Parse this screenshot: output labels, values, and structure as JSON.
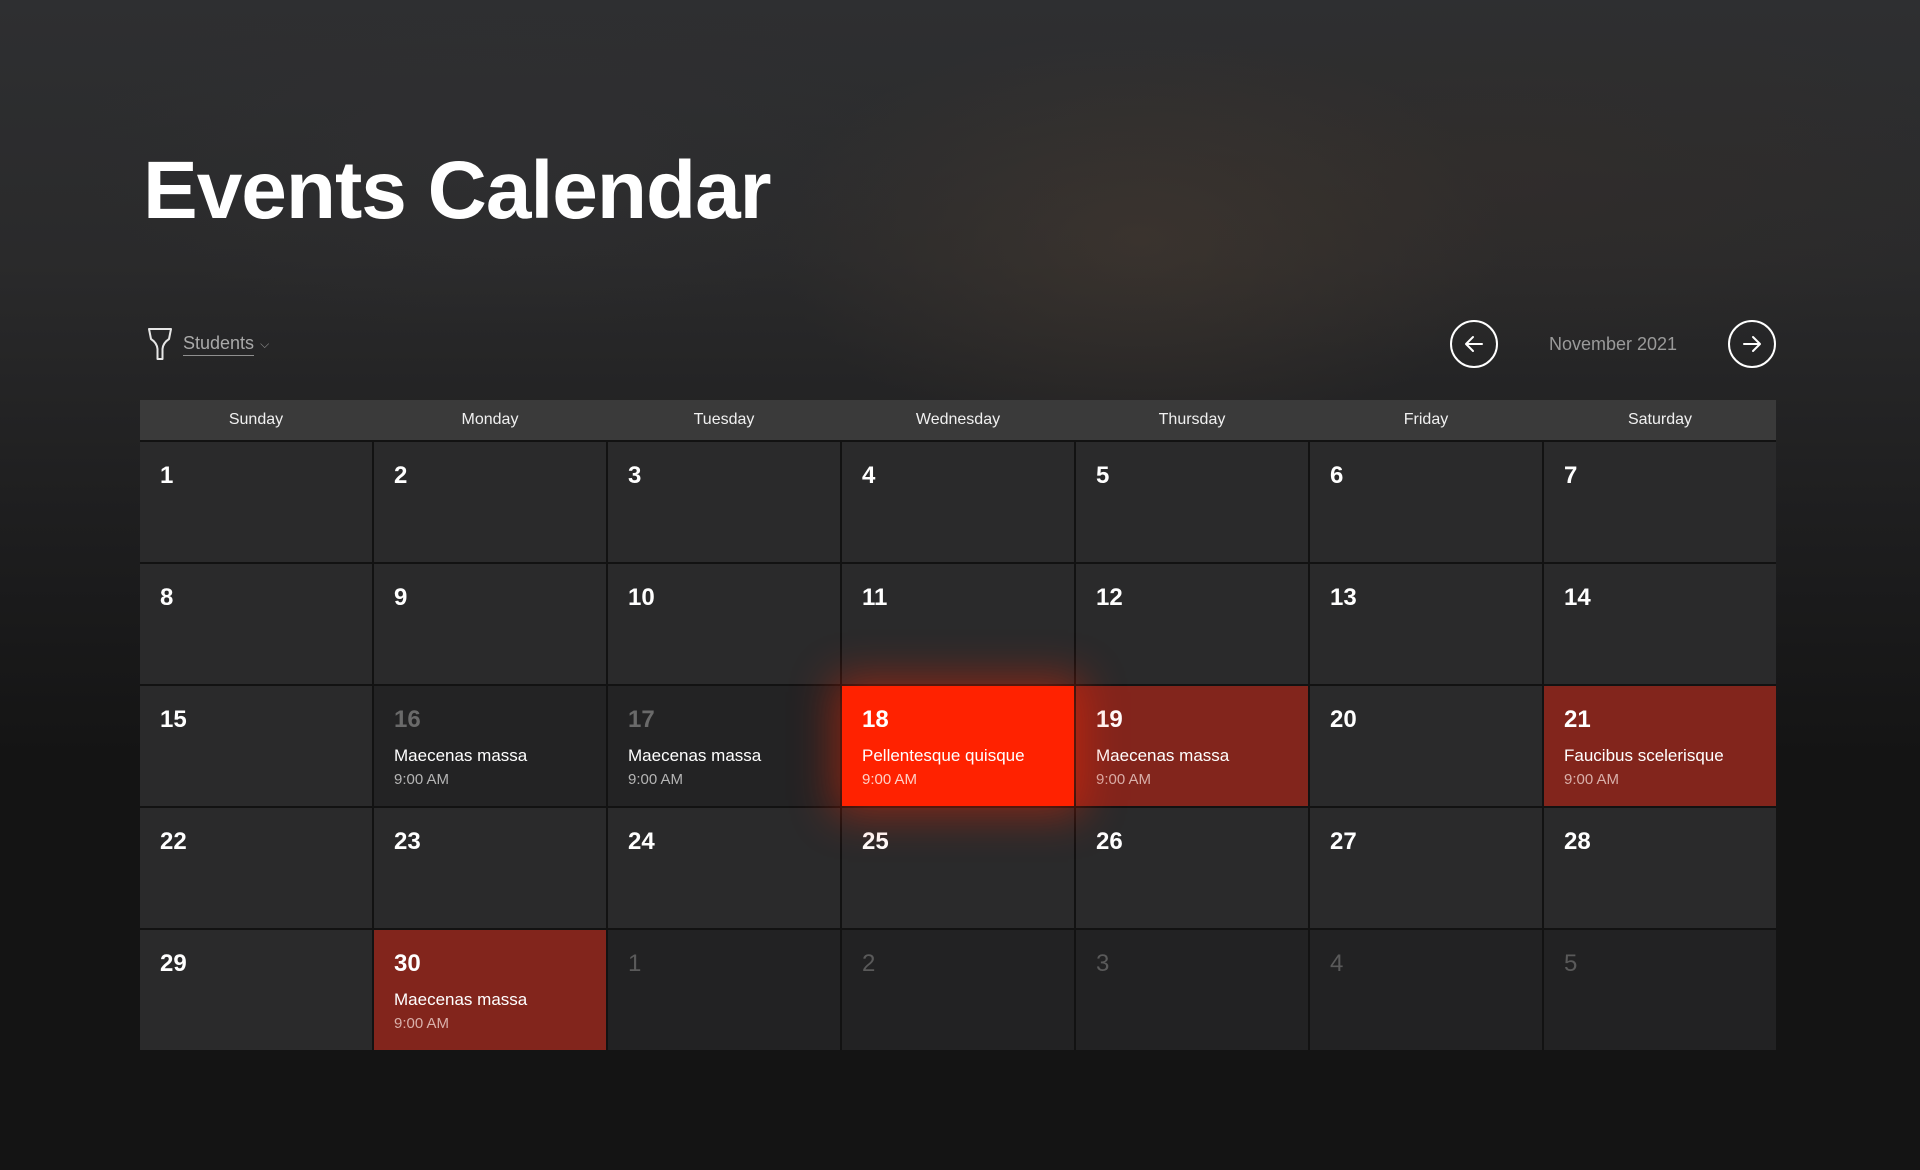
{
  "page": {
    "title": "Events Calendar",
    "accent_color": "#ff2200",
    "event_color": "#82251c"
  },
  "filter": {
    "icon": "funnel-icon",
    "label": "Students",
    "chevron": "⌵"
  },
  "month_nav": {
    "prev_icon": "arrow-left-icon",
    "next_icon": "arrow-right-icon",
    "label": "November 2021"
  },
  "weekdays": [
    "Sunday",
    "Monday",
    "Tuesday",
    "Wednesday",
    "Thursday",
    "Friday",
    "Saturday"
  ],
  "days": [
    {
      "day": "1"
    },
    {
      "day": "2"
    },
    {
      "day": "3"
    },
    {
      "day": "4"
    },
    {
      "day": "5"
    },
    {
      "day": "6"
    },
    {
      "day": "7"
    },
    {
      "day": "8"
    },
    {
      "day": "9"
    },
    {
      "day": "10"
    },
    {
      "day": "11"
    },
    {
      "day": "12"
    },
    {
      "day": "13"
    },
    {
      "day": "14"
    },
    {
      "day": "15"
    },
    {
      "day": "16",
      "state": "dim",
      "event": {
        "title": "Maecenas massa",
        "time": "9:00 AM"
      }
    },
    {
      "day": "17",
      "state": "dim",
      "event": {
        "title": "Maecenas massa",
        "time": "9:00 AM"
      }
    },
    {
      "day": "18",
      "state": "event-bright",
      "event": {
        "title": "Pellentesque quisque",
        "time": "9:00 AM"
      }
    },
    {
      "day": "19",
      "state": "event-dark",
      "event": {
        "title": "Maecenas massa",
        "time": "9:00 AM"
      }
    },
    {
      "day": "20"
    },
    {
      "day": "21",
      "state": "event-dark",
      "event": {
        "title": "Faucibus scelerisque",
        "time": "9:00 AM"
      }
    },
    {
      "day": "22"
    },
    {
      "day": "23"
    },
    {
      "day": "24"
    },
    {
      "day": "25"
    },
    {
      "day": "26"
    },
    {
      "day": "27"
    },
    {
      "day": "28"
    },
    {
      "day": "29"
    },
    {
      "day": "30",
      "state": "event-dark",
      "event": {
        "title": "Maecenas massa",
        "time": "9:00 AM"
      }
    },
    {
      "day": "1",
      "state": "other"
    },
    {
      "day": "2",
      "state": "other"
    },
    {
      "day": "3",
      "state": "other"
    },
    {
      "day": "4",
      "state": "other"
    },
    {
      "day": "5",
      "state": "other"
    }
  ]
}
